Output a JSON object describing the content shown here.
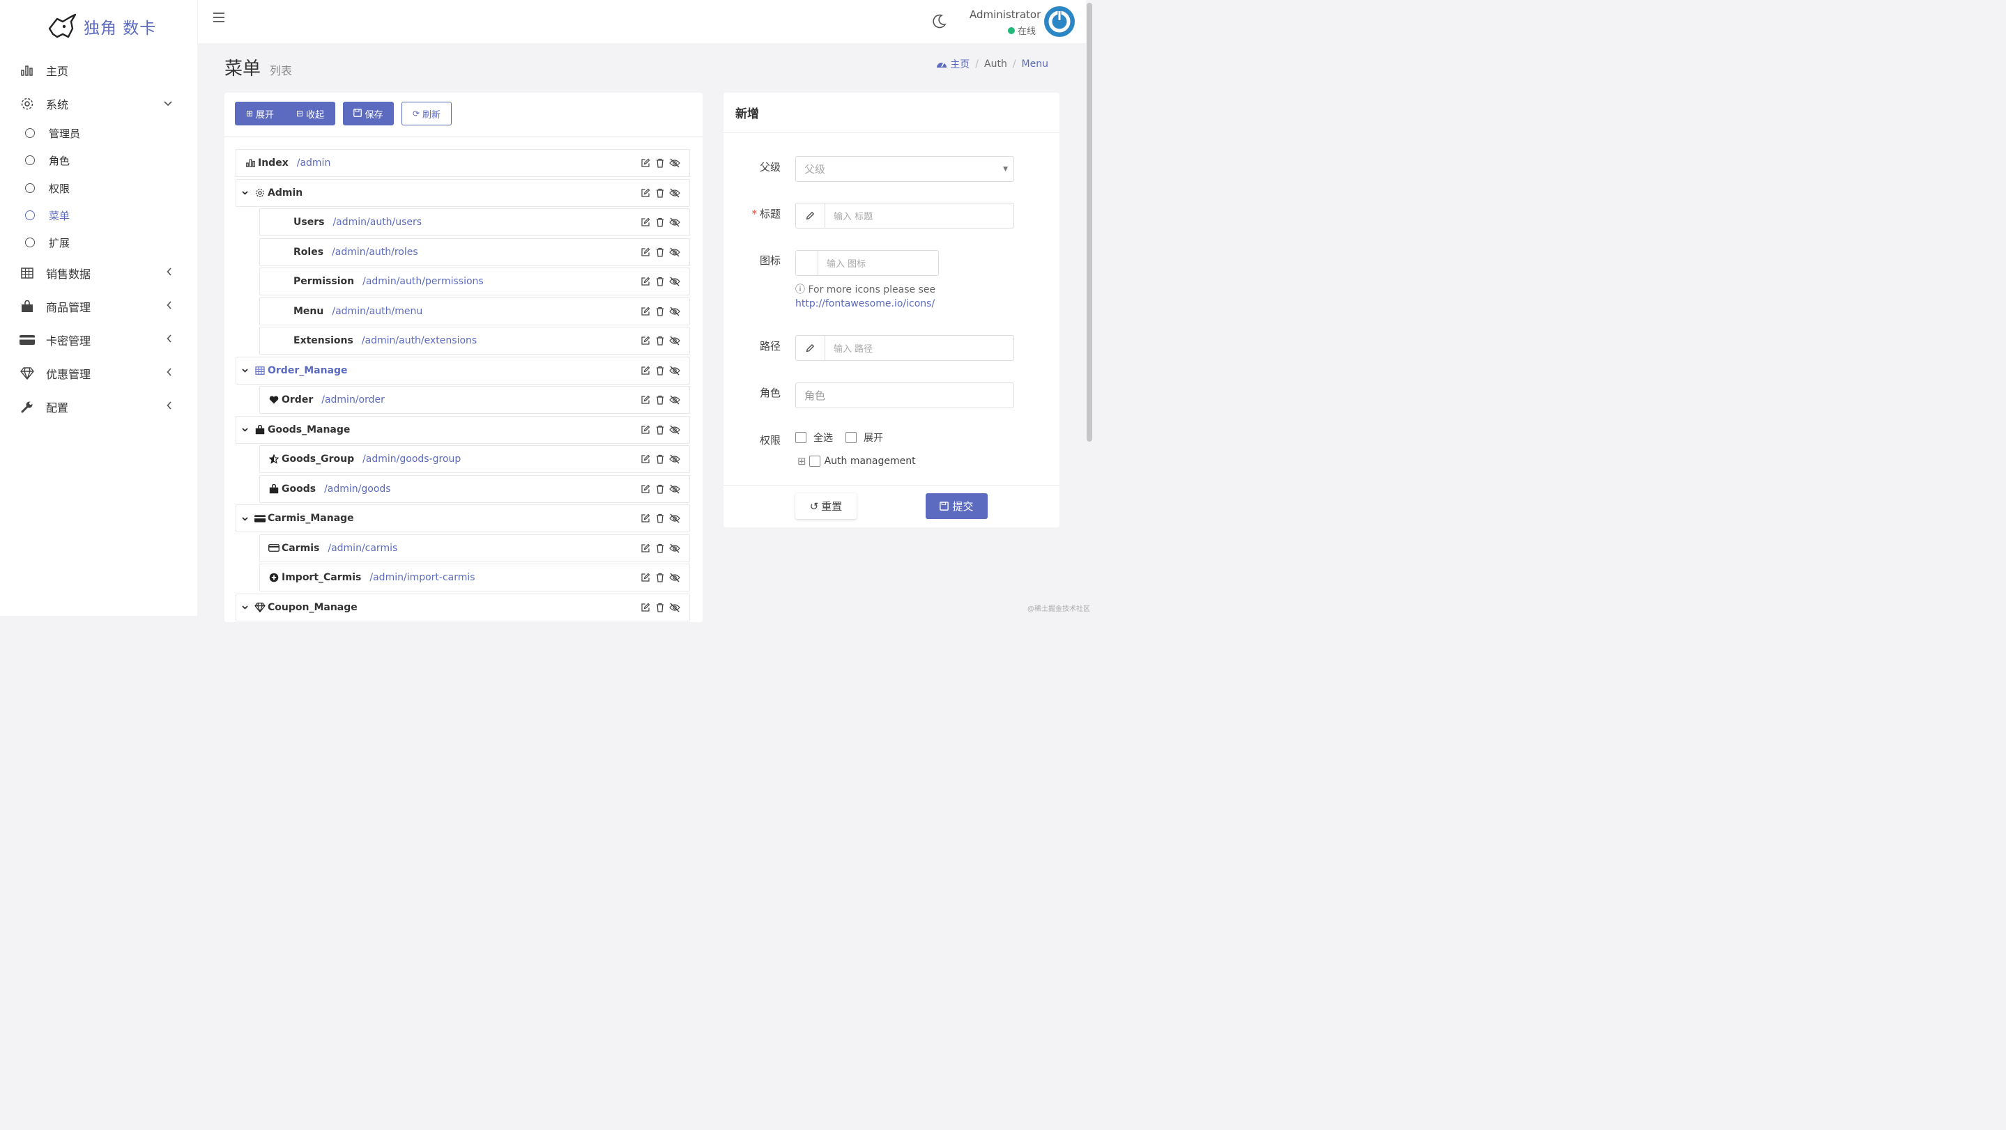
{
  "brand": {
    "name": "独角 数卡"
  },
  "sidebar": {
    "items": [
      {
        "label": "主页",
        "icon": "bar-chart-icon"
      },
      {
        "label": "系统",
        "icon": "gear-icon",
        "expanded": true
      },
      {
        "label": "销售数据",
        "icon": "table-icon"
      },
      {
        "label": "商品管理",
        "icon": "shopping-bag-icon"
      },
      {
        "label": "卡密管理",
        "icon": "credit-card-icon"
      },
      {
        "label": "优惠管理",
        "icon": "diamond-icon"
      },
      {
        "label": "配置",
        "icon": "wrench-icon"
      }
    ],
    "sub_items": [
      {
        "label": "管理员"
      },
      {
        "label": "角色"
      },
      {
        "label": "权限"
      },
      {
        "label": "菜单",
        "active": true
      },
      {
        "label": "扩展"
      }
    ]
  },
  "header": {
    "user_name": "Administrator",
    "status": "在线"
  },
  "page": {
    "title": "菜单",
    "subtitle": "列表"
  },
  "breadcrumb": {
    "home": "主页",
    "auth": "Auth",
    "current": "Menu"
  },
  "toolbar": {
    "expand": "展开",
    "collapse": "收起",
    "save": "保存",
    "refresh": "刷新"
  },
  "tree": [
    {
      "title": "Index",
      "path": "/admin",
      "icon": "bar-chart-icon"
    },
    {
      "title": "Admin",
      "path": "",
      "icon": "gear-icon",
      "parent": true
    },
    {
      "title": "Users",
      "path": "/admin/auth/users",
      "child": true
    },
    {
      "title": "Roles",
      "path": "/admin/auth/roles",
      "child": true
    },
    {
      "title": "Permission",
      "path": "/admin/auth/permissions",
      "child": true
    },
    {
      "title": "Menu",
      "path": "/admin/auth/menu",
      "child": true
    },
    {
      "title": "Extensions",
      "path": "/admin/auth/extensions",
      "child": true
    },
    {
      "title": "Order_Manage",
      "path": "",
      "icon": "table-icon",
      "parent": true,
      "link": true
    },
    {
      "title": "Order",
      "path": "/admin/order",
      "icon": "heart-icon",
      "child": true
    },
    {
      "title": "Goods_Manage",
      "path": "",
      "icon": "shopping-bag-icon",
      "parent": true
    },
    {
      "title": "Goods_Group",
      "path": "/admin/goods-group",
      "icon": "star-half-icon",
      "child": true
    },
    {
      "title": "Goods",
      "path": "/admin/goods",
      "icon": "shopping-bag-icon",
      "child": true
    },
    {
      "title": "Carmis_Manage",
      "path": "",
      "icon": "credit-card-icon",
      "parent": true
    },
    {
      "title": "Carmis",
      "path": "/admin/carmis",
      "icon": "credit-card-icon",
      "child": true
    },
    {
      "title": "Import_Carmis",
      "path": "/admin/import-carmis",
      "icon": "plus-circle-icon",
      "child": true
    },
    {
      "title": "Coupon_Manage",
      "path": "",
      "icon": "diamond-icon",
      "parent": true
    }
  ],
  "form": {
    "title": "新增",
    "parent_label": "父级",
    "parent_placeholder": "父级",
    "title_label": "标题",
    "title_placeholder": "输入 标题",
    "icon_label": "图标",
    "icon_placeholder": "输入 图标",
    "icon_help": "For more icons please see",
    "icon_help_link": "http://fontawesome.io/icons/",
    "path_label": "路径",
    "path_placeholder": "输入 路径",
    "role_label": "角色",
    "role_placeholder": "角色",
    "perm_label": "权限",
    "select_all": "全选",
    "expand": "展开",
    "perm_node": "Auth management",
    "reset": "重置",
    "submit": "提交"
  },
  "watermark": "@稀土掘金技术社区",
  "colors": {
    "accent": "#5c6bc0",
    "online": "#21b978"
  }
}
